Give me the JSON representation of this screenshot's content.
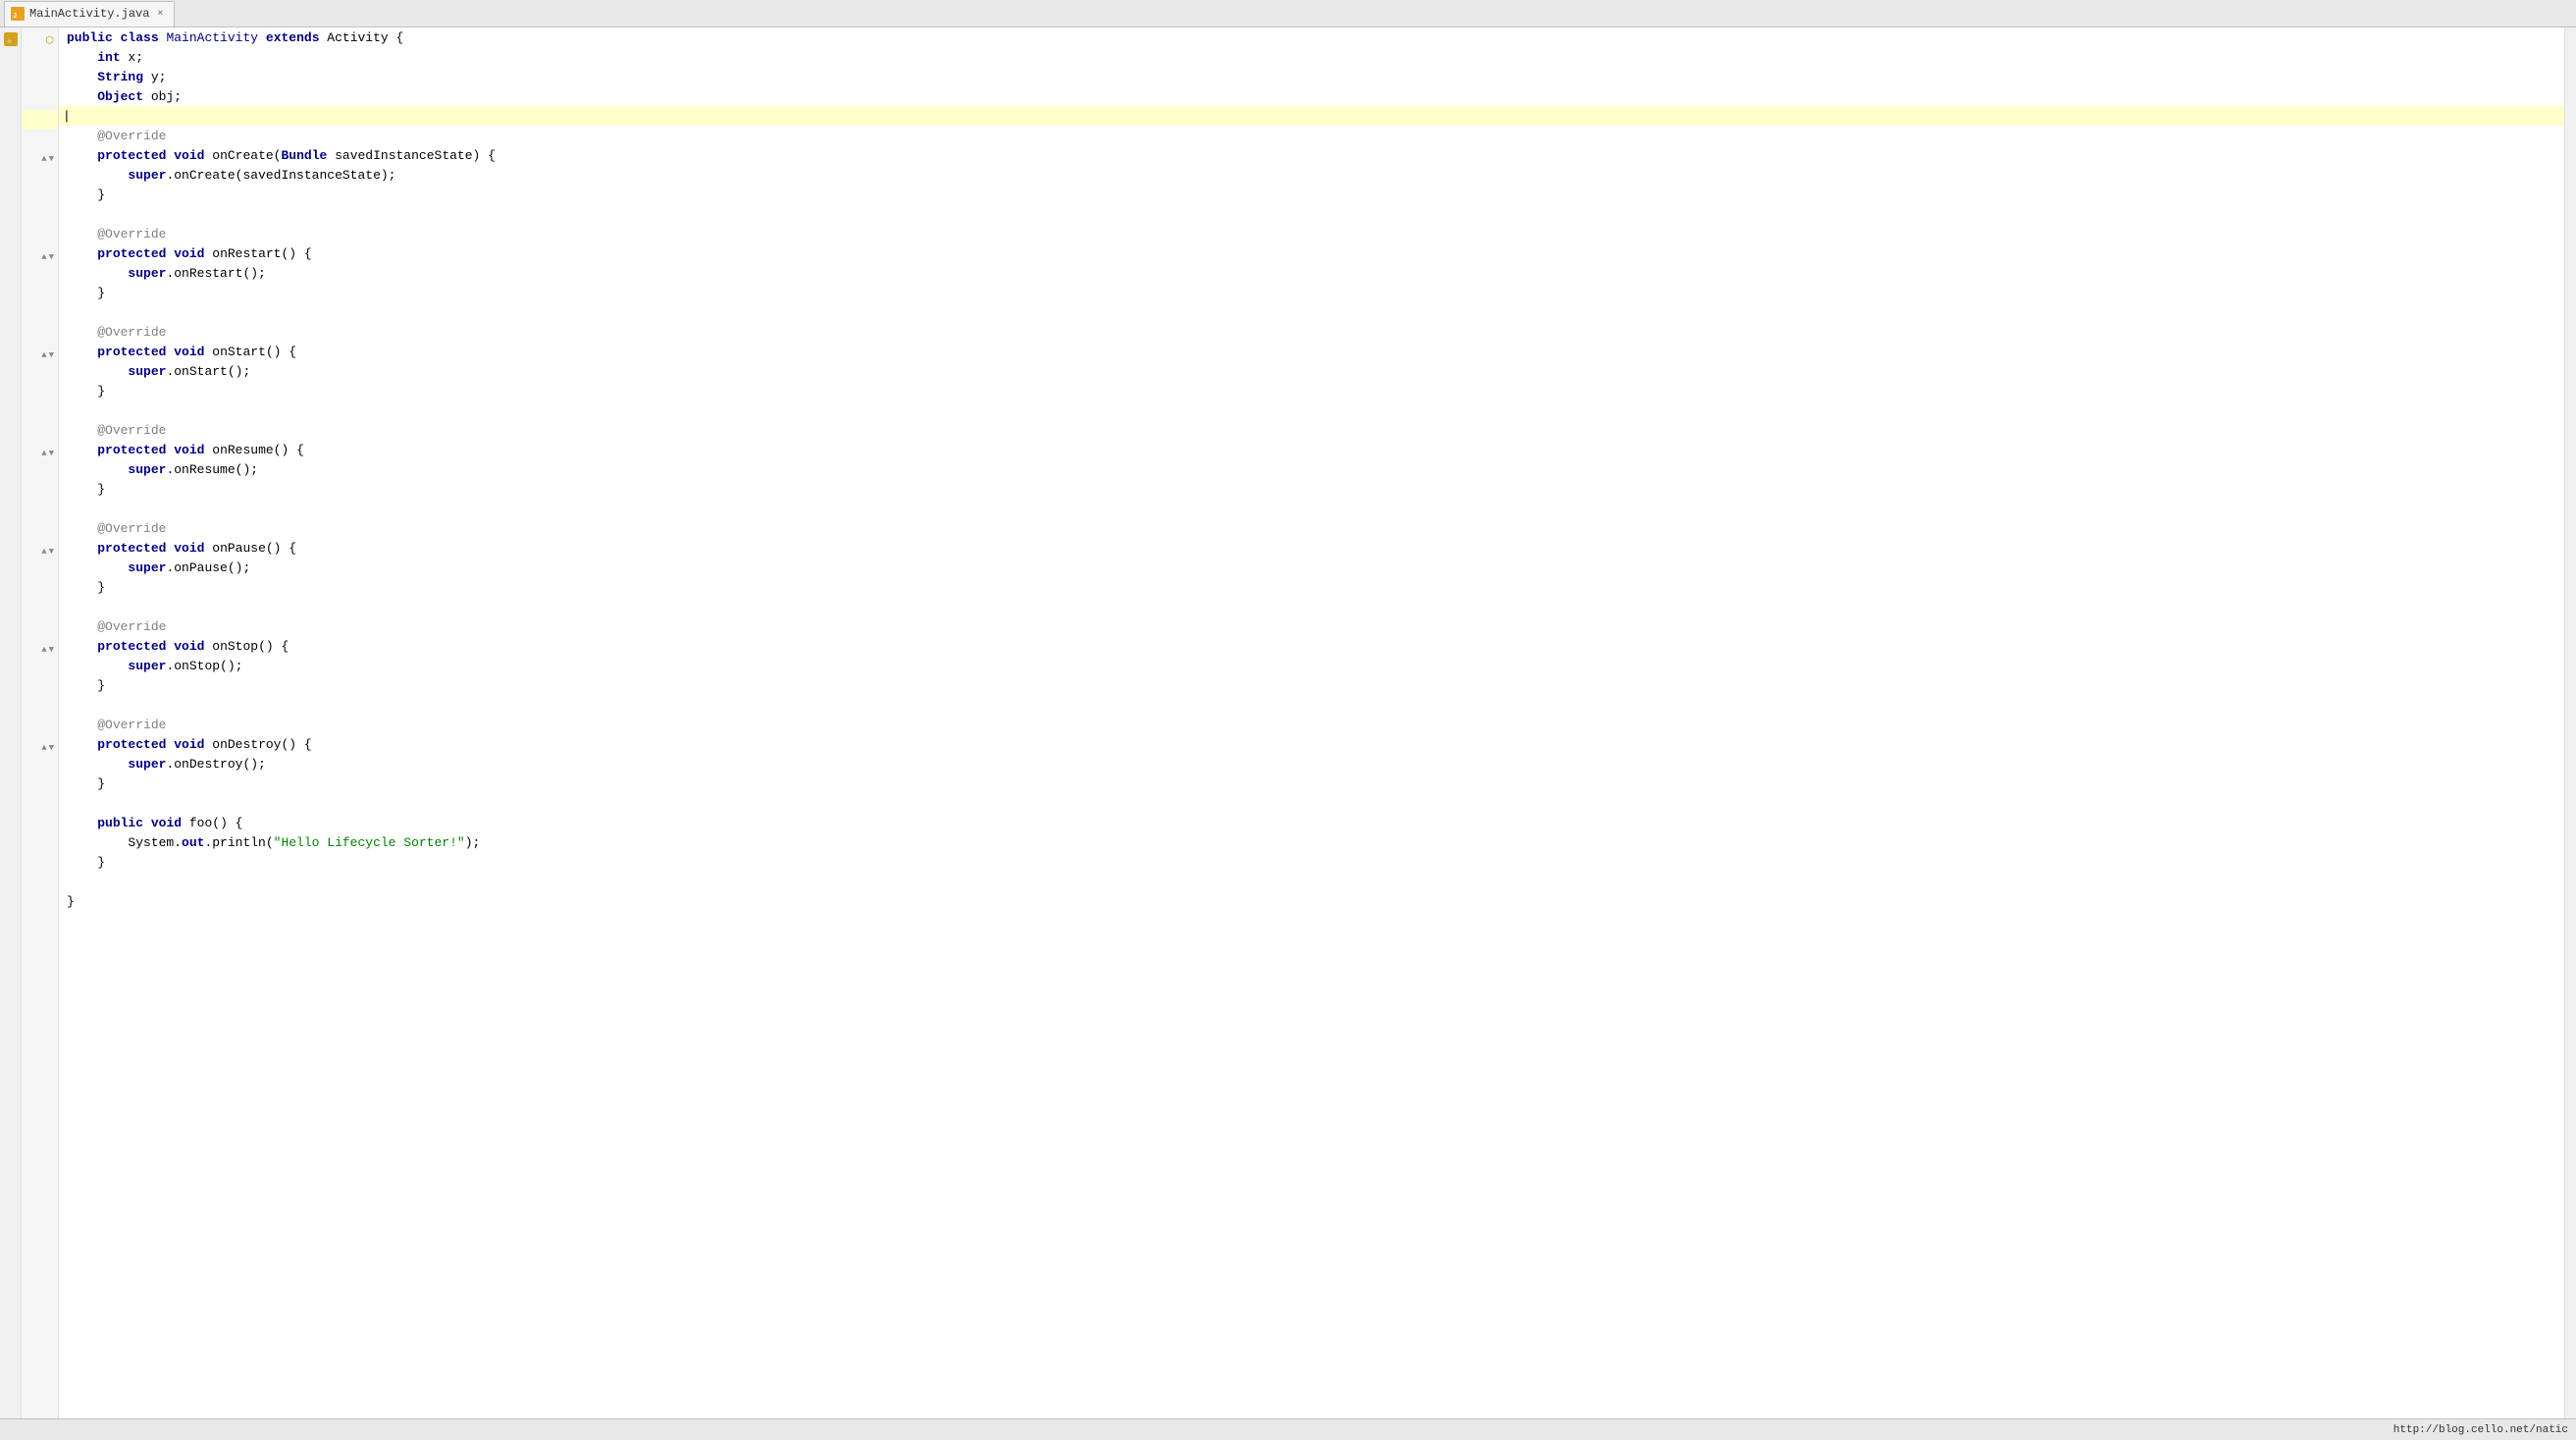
{
  "tab": {
    "label": "MainActivity.java",
    "close": "×"
  },
  "status_bar": {
    "url": "http://blog.cello.net/natic"
  },
  "code": {
    "lines": [
      {
        "id": 1,
        "content": "public class MainActivity extends Activity {",
        "type": "class-decl"
      },
      {
        "id": 2,
        "content": "    int x;",
        "type": "field"
      },
      {
        "id": 3,
        "content": "    String y;",
        "type": "field"
      },
      {
        "id": 4,
        "content": "    Object obj;",
        "type": "field"
      },
      {
        "id": 5,
        "content": "",
        "type": "blank",
        "highlighted": true
      },
      {
        "id": 6,
        "content": "    @Override",
        "type": "annotation"
      },
      {
        "id": 7,
        "content": "    protected void onCreate(Bundle savedInstanceState) {",
        "type": "method"
      },
      {
        "id": 8,
        "content": "        super.onCreate(savedInstanceState);",
        "type": "body"
      },
      {
        "id": 9,
        "content": "    }",
        "type": "close"
      },
      {
        "id": 10,
        "content": "",
        "type": "blank"
      },
      {
        "id": 11,
        "content": "    @Override",
        "type": "annotation"
      },
      {
        "id": 12,
        "content": "    protected void onRestart() {",
        "type": "method"
      },
      {
        "id": 13,
        "content": "        super.onRestart();",
        "type": "body"
      },
      {
        "id": 14,
        "content": "    }",
        "type": "close"
      },
      {
        "id": 15,
        "content": "",
        "type": "blank"
      },
      {
        "id": 16,
        "content": "    @Override",
        "type": "annotation"
      },
      {
        "id": 17,
        "content": "    protected void onStart() {",
        "type": "method"
      },
      {
        "id": 18,
        "content": "        super.onStart();",
        "type": "body"
      },
      {
        "id": 19,
        "content": "    }",
        "type": "close"
      },
      {
        "id": 20,
        "content": "",
        "type": "blank"
      },
      {
        "id": 21,
        "content": "    @Override",
        "type": "annotation"
      },
      {
        "id": 22,
        "content": "    protected void onResume() {",
        "type": "method"
      },
      {
        "id": 23,
        "content": "        super.onResume();",
        "type": "body"
      },
      {
        "id": 24,
        "content": "    }",
        "type": "close"
      },
      {
        "id": 25,
        "content": "",
        "type": "blank"
      },
      {
        "id": 26,
        "content": "    @Override",
        "type": "annotation"
      },
      {
        "id": 27,
        "content": "    protected void onPause() {",
        "type": "method"
      },
      {
        "id": 28,
        "content": "        super.onPause();",
        "type": "body"
      },
      {
        "id": 29,
        "content": "    }",
        "type": "close"
      },
      {
        "id": 30,
        "content": "",
        "type": "blank"
      },
      {
        "id": 31,
        "content": "    @Override",
        "type": "annotation"
      },
      {
        "id": 32,
        "content": "    protected void onStop() {",
        "type": "method"
      },
      {
        "id": 33,
        "content": "        super.onStop();",
        "type": "body"
      },
      {
        "id": 34,
        "content": "    }",
        "type": "close"
      },
      {
        "id": 35,
        "content": "",
        "type": "blank"
      },
      {
        "id": 36,
        "content": "    @Override",
        "type": "annotation"
      },
      {
        "id": 37,
        "content": "    protected void onDestroy() {",
        "type": "method"
      },
      {
        "id": 38,
        "content": "        super.onDestroy();",
        "type": "body"
      },
      {
        "id": 39,
        "content": "    }",
        "type": "close"
      },
      {
        "id": 40,
        "content": "",
        "type": "blank"
      },
      {
        "id": 41,
        "content": "    public void foo() {",
        "type": "method"
      },
      {
        "id": 42,
        "content": "        System.out.println(\"Hello Lifecycle Sorter!\");",
        "type": "body"
      },
      {
        "id": 43,
        "content": "    }",
        "type": "close"
      },
      {
        "id": 44,
        "content": "",
        "type": "blank"
      },
      {
        "id": 45,
        "content": "}",
        "type": "close-class"
      }
    ]
  }
}
